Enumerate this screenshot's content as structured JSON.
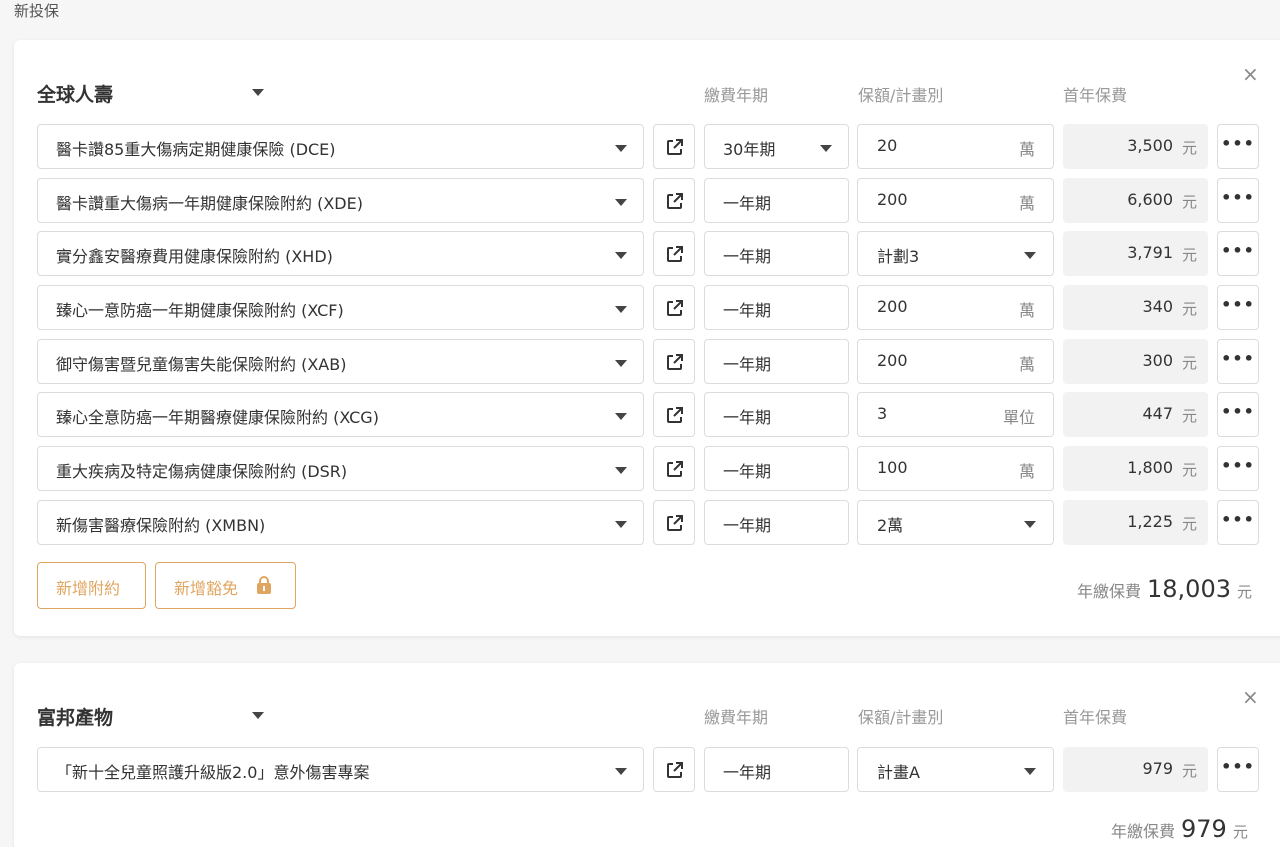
{
  "page": {
    "title": "新投保"
  },
  "headers": {
    "term": "繳費年期",
    "amount": "保額/計畫別",
    "premium": "首年保費"
  },
  "currency_unit": "元",
  "total_label": "年繳保費",
  "cards": [
    {
      "insurer": "全球人壽",
      "rows": [
        {
          "product": "醫卡讚85重大傷病定期健康保險 (DCE)",
          "term": "30年期",
          "term_dropdown": true,
          "amount": "20",
          "amount_unit": "萬",
          "amount_dropdown": false,
          "premium": "3,500"
        },
        {
          "product": "醫卡讚重大傷病一年期健康保險附約 (XDE)",
          "term": "一年期",
          "term_dropdown": false,
          "amount": "200",
          "amount_unit": "萬",
          "amount_dropdown": false,
          "premium": "6,600"
        },
        {
          "product": "實分鑫安醫療費用健康保險附約 (XHD)",
          "term": "一年期",
          "term_dropdown": false,
          "amount": "計劃3",
          "amount_unit": "",
          "amount_dropdown": true,
          "premium": "3,791"
        },
        {
          "product": "臻心一意防癌一年期健康保險附約 (XCF)",
          "term": "一年期",
          "term_dropdown": false,
          "amount": "200",
          "amount_unit": "萬",
          "amount_dropdown": false,
          "premium": "340"
        },
        {
          "product": "御守傷害暨兒童傷害失能保險附約 (XAB)",
          "term": "一年期",
          "term_dropdown": false,
          "amount": "200",
          "amount_unit": "萬",
          "amount_dropdown": false,
          "premium": "300"
        },
        {
          "product": "臻心全意防癌一年期醫療健康保險附約 (XCG)",
          "term": "一年期",
          "term_dropdown": false,
          "amount": "3",
          "amount_unit": "單位",
          "amount_dropdown": false,
          "premium": "447"
        },
        {
          "product": "重大疾病及特定傷病健康保險附約 (DSR)",
          "term": "一年期",
          "term_dropdown": false,
          "amount": "100",
          "amount_unit": "萬",
          "amount_dropdown": false,
          "premium": "1,800"
        },
        {
          "product": "新傷害醫療保險附約 (XMBN)",
          "term": "一年期",
          "term_dropdown": false,
          "amount": "2萬",
          "amount_unit": "",
          "amount_dropdown": true,
          "premium": "1,225"
        }
      ],
      "buttons": {
        "add_rider": "新增附約",
        "add_waiver": "新增豁免"
      },
      "total": "18,003"
    },
    {
      "insurer": "富邦產物",
      "rows": [
        {
          "product": "「新十全兒童照護升級版2.0」意外傷害專案",
          "term": "一年期",
          "term_dropdown": false,
          "amount": "計畫A",
          "amount_unit": "",
          "amount_dropdown": true,
          "premium": "979"
        }
      ],
      "total": "979"
    }
  ],
  "colors": {
    "accent": "#e0a560",
    "premium_bg": "#f2f2f2"
  },
  "icons": {
    "external": "external-link-icon",
    "more": "more-horizontal-icon",
    "lock": "lock-icon",
    "close": "close-icon",
    "caret": "chevron-down-icon"
  }
}
